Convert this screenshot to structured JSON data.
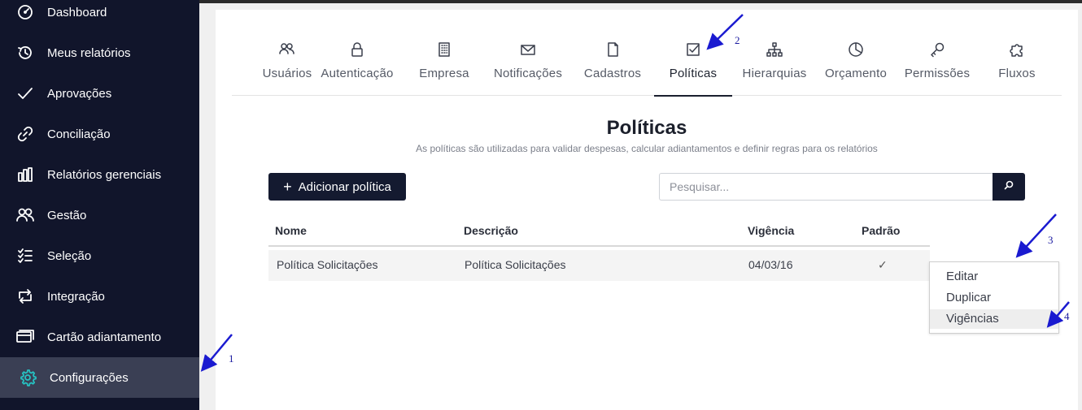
{
  "sidebar": {
    "items": [
      {
        "label": "Dashboard",
        "icon": "dashboard-icon"
      },
      {
        "label": "Meus relatórios",
        "icon": "history-icon"
      },
      {
        "label": "Aprovações",
        "icon": "checkmark-icon"
      },
      {
        "label": "Conciliação",
        "icon": "link-icon"
      },
      {
        "label": "Relatórios gerenciais",
        "icon": "bar-chart-icon"
      },
      {
        "label": "Gestão",
        "icon": "users-icon"
      },
      {
        "label": "Seleção",
        "icon": "checklist-icon"
      },
      {
        "label": "Integração",
        "icon": "sync-icon"
      },
      {
        "label": "Cartão adiantamento",
        "icon": "card-icon"
      },
      {
        "label": "Configurações",
        "icon": "gear-icon",
        "active": true
      }
    ]
  },
  "tabs": [
    {
      "label": "Usuários",
      "icon": "users-icon"
    },
    {
      "label": "Autenticação",
      "icon": "lock-icon"
    },
    {
      "label": "Empresa",
      "icon": "building-icon"
    },
    {
      "label": "Notificações",
      "icon": "envelope-icon"
    },
    {
      "label": "Cadastros",
      "icon": "document-icon"
    },
    {
      "label": "Políticas",
      "icon": "checkbox-icon",
      "active": true
    },
    {
      "label": "Hierarquias",
      "icon": "org-chart-icon"
    },
    {
      "label": "Orçamento",
      "icon": "pie-chart-icon"
    },
    {
      "label": "Permissões",
      "icon": "key-icon"
    },
    {
      "label": "Fluxos",
      "icon": "puzzle-icon"
    }
  ],
  "page": {
    "title": "Políticas",
    "subtitle": "As políticas são utilizadas para validar despesas, calcular adiantamentos e definir regras para os relatórios"
  },
  "toolbar": {
    "add_label": "Adicionar política",
    "search_placeholder": "Pesquisar..."
  },
  "table": {
    "columns": [
      "Nome",
      "Descrição",
      "Vigência",
      "Padrão"
    ],
    "rows": [
      {
        "nome": "Política Solicitações",
        "descricao": "Política Solicitações",
        "vigencia": "04/03/16",
        "padrao": "✓"
      }
    ]
  },
  "context_menu": {
    "items": [
      "Editar",
      "Duplicar",
      "Vigências"
    ],
    "hovered": "Vigências"
  },
  "annotations": [
    "1",
    "2",
    "3",
    "4"
  ],
  "colors": {
    "sidebar_bg": "#11152b",
    "active_item_bg": "#3a3f54",
    "accent_icon": "#26c2c2",
    "button_bg": "#141a30",
    "annotation_arrow": "#1a1ad0"
  }
}
